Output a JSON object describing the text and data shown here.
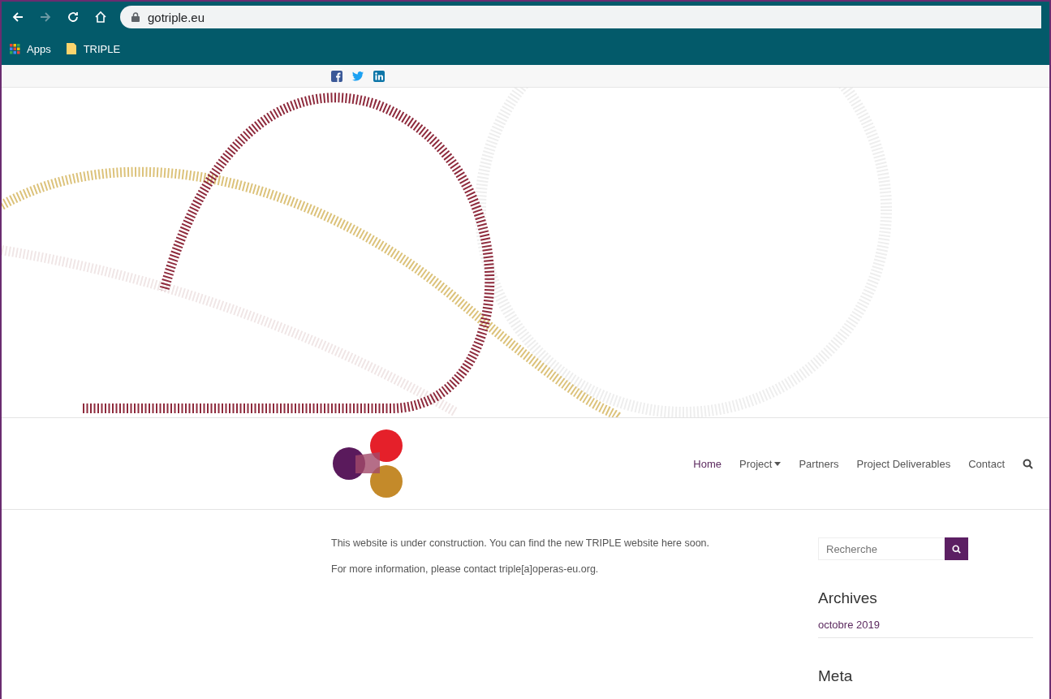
{
  "browser": {
    "url": "gotriple.eu",
    "bookmarks": [
      {
        "label": "Apps",
        "kind": "apps"
      },
      {
        "label": "TRIPLE",
        "kind": "folder"
      }
    ]
  },
  "social": [
    {
      "kind": "facebook"
    },
    {
      "kind": "twitter"
    },
    {
      "kind": "linkedin"
    }
  ],
  "nav": [
    {
      "label": "Home",
      "selected": true,
      "dropdown": false
    },
    {
      "label": "Project",
      "selected": false,
      "dropdown": true
    },
    {
      "label": "Partners",
      "selected": false,
      "dropdown": false
    },
    {
      "label": "Project Deliverables",
      "selected": false,
      "dropdown": false
    },
    {
      "label": "Contact",
      "selected": false,
      "dropdown": false
    }
  ],
  "content": {
    "paragraphs": [
      "This website is under construction. You can find the new TRIPLE website here soon.",
      "For more information, please contact triple[a]operas-eu.org."
    ]
  },
  "sidebar": {
    "search": {
      "placeholder": "Recherche"
    },
    "widgets": [
      {
        "title": "Archives",
        "links": [
          "octobre 2019"
        ]
      },
      {
        "title": "Meta"
      }
    ]
  }
}
